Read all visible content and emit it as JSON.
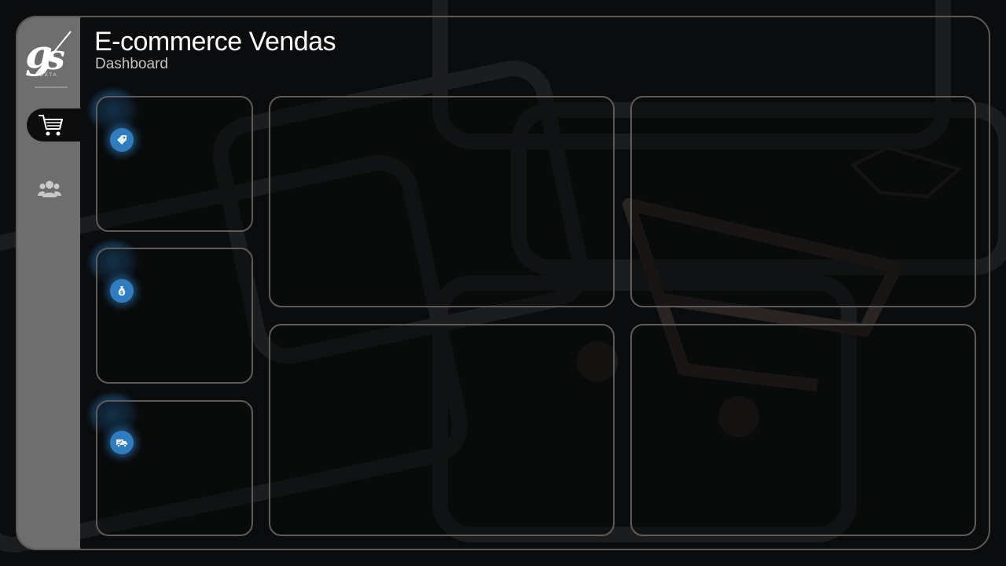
{
  "header": {
    "title": "E-commerce Vendas",
    "subtitle": "Dashboard"
  },
  "logo": {
    "text": "gs",
    "sub": "DATA"
  },
  "sidebar": {
    "items": [
      {
        "icon": "cart-icon",
        "active": true
      },
      {
        "icon": "users-icon",
        "active": false
      }
    ]
  },
  "kpis": [
    {
      "icon": "tag-icon"
    },
    {
      "icon": "money-bag-icon"
    },
    {
      "icon": "delivery-truck-icon"
    }
  ],
  "colors": {
    "accent": "#2f7dbf",
    "card_border": "#5c5c5c",
    "sidebar": "#6e6e6e",
    "background": "#0b0c0d"
  }
}
